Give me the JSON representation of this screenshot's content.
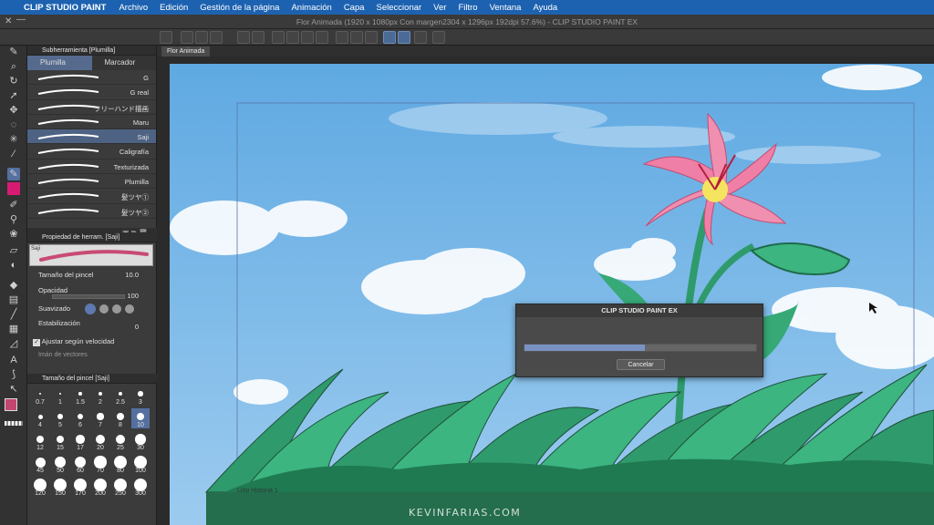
{
  "menubar": {
    "app_name": "CLIP STUDIO PAINT",
    "items": [
      "Archivo",
      "Edición",
      "Gestión de la página",
      "Animación",
      "Capa",
      "Seleccionar",
      "Ver",
      "Filtro",
      "Ventana",
      "Ayuda"
    ]
  },
  "window": {
    "title": "Flor Animada (1920 x 1080px Con margen2304 x 1296px 192dpi 57.6%)  - CLIP STUDIO PAINT EX"
  },
  "canvas_tab": {
    "label": "Flor Animada"
  },
  "subtool_panel": {
    "title": "Subherramienta [Plumilla]",
    "tabs": [
      "Plumilla",
      "Marcador"
    ],
    "brushes": [
      {
        "label": "G"
      },
      {
        "label": "G real"
      },
      {
        "label": "フリーハンド描画"
      },
      {
        "label": "Maru"
      },
      {
        "label": "Saji",
        "selected": true
      },
      {
        "label": "Caligrafía"
      },
      {
        "label": "Texturizada"
      },
      {
        "label": "Plumilla"
      },
      {
        "label": "髪ツヤ①"
      },
      {
        "label": "髪ツヤ②"
      }
    ]
  },
  "tool_property": {
    "title": "Propiedad de herram. [Saji]",
    "preview_label": "Saji",
    "brush_size_label": "Tamaño del pincel",
    "brush_size_value": "10.0",
    "opacity_label": "Opacidad",
    "opacity_value": "100",
    "smoothing_label": "Suavizado",
    "stabilization_label": "Estabilización",
    "stabilization_value": "0",
    "speed_label": "Ajustar según velocidad",
    "vector_label": "Imán de vectores"
  },
  "brush_size_panel": {
    "title": "Tamaño del pincel [Saji]",
    "sizes_row1": [
      "0.7",
      "1",
      "1.5",
      "2",
      "2.5",
      "3"
    ],
    "sizes_row2": [
      "4",
      "5",
      "6",
      "7",
      "8",
      "10"
    ],
    "sizes_row3": [
      "12",
      "15",
      "17",
      "20",
      "25",
      "30"
    ],
    "sizes_row4": [
      "45",
      "50",
      "60",
      "70",
      "80",
      "100"
    ],
    "sizes_row5": [
      "120",
      "150",
      "170",
      "200",
      "250",
      "300"
    ],
    "selected": "10"
  },
  "canvas": {
    "layer_label": "Lirio Historia 1"
  },
  "dialog": {
    "title": "CLIP STUDIO PAINT EX",
    "progress": 0.52,
    "cancel_label": "Cancelar"
  },
  "watermark": "KEVINFARIAS.COM",
  "colors": {
    "accent": "#5570a0",
    "menubar": "#1d62b0",
    "main_color": "#d81b72"
  }
}
